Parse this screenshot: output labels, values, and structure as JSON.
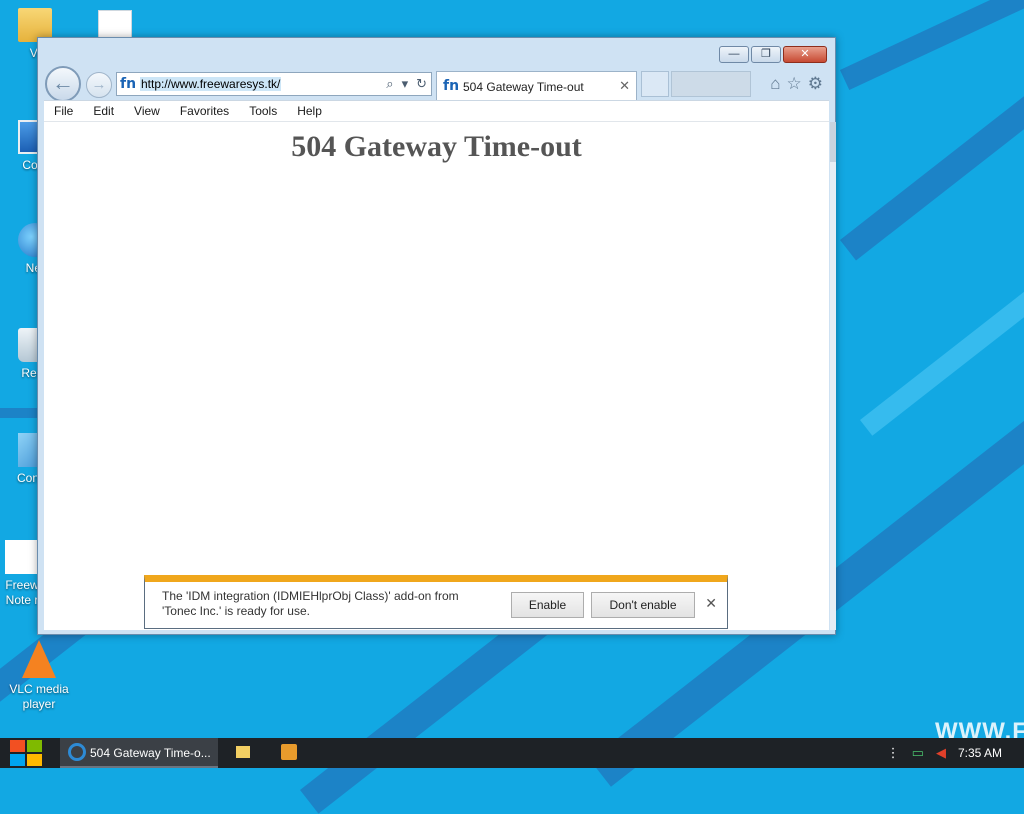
{
  "desktop": {
    "icons": [
      {
        "label": "Vi",
        "icon": "folder-icon"
      },
      {
        "label": "",
        "icon": "document-icon"
      },
      {
        "label": "Com",
        "icon": "computer-icon"
      },
      {
        "label": "Net",
        "icon": "network-icon"
      },
      {
        "label": "Recy",
        "icon": "recycle-bin-icon"
      },
      {
        "label": "Contro",
        "icon": "control-panel-icon"
      },
      {
        "label": "Freew Note r",
        "icon": "document-icon"
      },
      {
        "label": "VLC media player",
        "icon": "vlc-icon"
      }
    ],
    "watermark": "WWW.FR"
  },
  "browser": {
    "address_url": "http://www.freewaresys.tk/",
    "tab_title": "504 Gateway Time-out",
    "menu": [
      "File",
      "Edit",
      "View",
      "Favorites",
      "Tools",
      "Help"
    ],
    "page_heading": "504 Gateway Time-out",
    "notification": {
      "message": "The 'IDM integration (IDMIEHlprObj Class)' add-on from 'Tonec Inc.' is ready for use.",
      "enable_label": "Enable",
      "dont_enable_label": "Don't enable"
    }
  },
  "taskbar": {
    "active_task": "504 Gateway Time-o...",
    "clock": "7:35 AM"
  },
  "colors": {
    "desktop_bg": "#12a8e3",
    "notification_accent": "#f0a71c",
    "close_button": "#c74a33"
  }
}
